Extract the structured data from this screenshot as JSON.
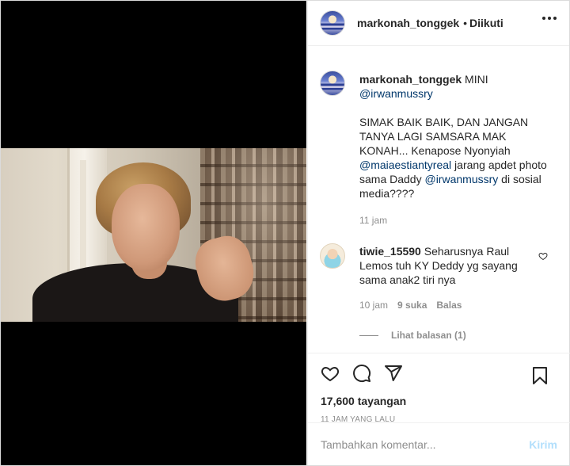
{
  "header": {
    "username": "markonah_tonggek",
    "separator": "•",
    "follow_status": "Diikuti"
  },
  "post": {
    "username": "markonah_tonggek",
    "caption_lead": "MINI",
    "mention_1": "@irwanmussry",
    "paragraph_2_text": "SIMAK BAIK BAIK, DAN JANGAN TANYA LAGI SAMSARA MAK KONAH... Kenapose Nyonyiah",
    "mention_2": "@maiaestiantyreal",
    "paragraph_2_mid": "jarang apdet photo sama Daddy",
    "mention_3": "@irwanmussry",
    "paragraph_2_end": "di sosial media????",
    "time": "11 jam"
  },
  "comment": {
    "username": "tiwie_15590",
    "text": "Seharusnya Raul Lemos tuh KY Deddy yg sayang sama anak2 tiri nya",
    "time": "10 jam",
    "likes": "9 suka",
    "reply_label": "Balas",
    "view_replies": "Lihat balasan (1)"
  },
  "actions": {
    "views": "17,600 tayangan",
    "timestamp": "11 JAM YANG LALU"
  },
  "add_comment": {
    "placeholder": "Tambahkan komentar...",
    "post_label": "Kirim"
  },
  "colors": {
    "text": "#262626",
    "muted": "#8e8e8e",
    "mention": "#00376b",
    "post_button_disabled": "#b2dffc"
  },
  "icons": [
    "more-options-icon",
    "heart-icon",
    "comment-icon",
    "share-icon",
    "bookmark-icon",
    "small-heart-icon"
  ]
}
